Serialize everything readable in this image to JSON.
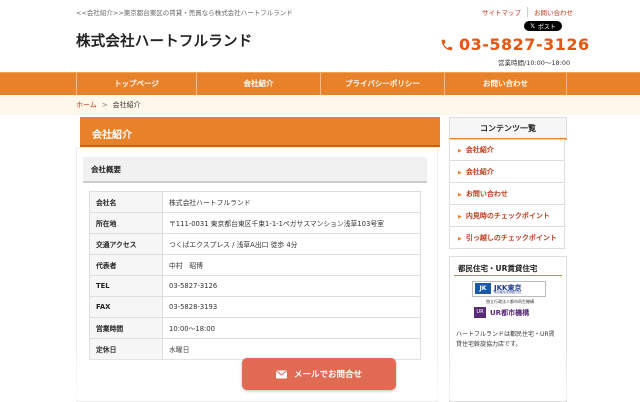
{
  "header": {
    "tagline": "<<会社紹介>>東京都台東区の賃貸・売買なら株式会社ハートフルランド",
    "top_links": [
      "サイトマップ",
      "お問い合わせ"
    ],
    "x_post_label": "ポスト",
    "brand": "株式会社ハートフルランド",
    "phone": "03-5827-3126",
    "hours": "営業時間/10:00～18:00"
  },
  "nav": {
    "items": [
      "トップページ",
      "会社紹介",
      "プライバシーポリシー",
      "お問い合わせ"
    ]
  },
  "breadcrumb": {
    "home": "ホーム",
    "separator": ">",
    "current": "会社紹介"
  },
  "main": {
    "title": "会社紹介",
    "section_title": "会社概要",
    "rows": [
      {
        "key": "会社名",
        "value": "株式会社ハートフルランド"
      },
      {
        "key": "所在地",
        "value": "〒111-0031 東京都台東区千束1-1-1ペガサスマンション浅草103号室"
      },
      {
        "key": "交通アクセス",
        "value": "つくばエクスプレス / 浅草A出口 徒歩 4分"
      },
      {
        "key": "代表者",
        "value": "中村　昭博"
      },
      {
        "key": "TEL",
        "value": "03-5827-3126"
      },
      {
        "key": "FAX",
        "value": "03-5828-3193"
      },
      {
        "key": "営業時間",
        "value": "10:00～18:00"
      },
      {
        "key": "定休日",
        "value": "水曜日"
      }
    ]
  },
  "sidebar": {
    "title": "コンテンツ一覧",
    "items": [
      "会社紹介",
      "会社紹介",
      "お問い合わせ",
      "内見時のチェックポイント",
      "引っ越しのチェックポイント"
    ],
    "ur_title": "都民住宅・UR賃貸住宅",
    "jkk_logo": "JKK東京",
    "jkk_sub": "東京都住宅供給公社",
    "ur_caption": "独立行政法人都市再生機構",
    "ur_logo": "UR都市機構",
    "ur_text": "ハートフルランドは都民住宅・UR賃貸住宅斡旋協力店です。"
  },
  "cta": {
    "mail_label": "メールでお問合せ"
  },
  "colors": {
    "accent": "#e8822a",
    "phone": "#e8550f",
    "link": "#c0391b",
    "cta": "#e06a52"
  }
}
